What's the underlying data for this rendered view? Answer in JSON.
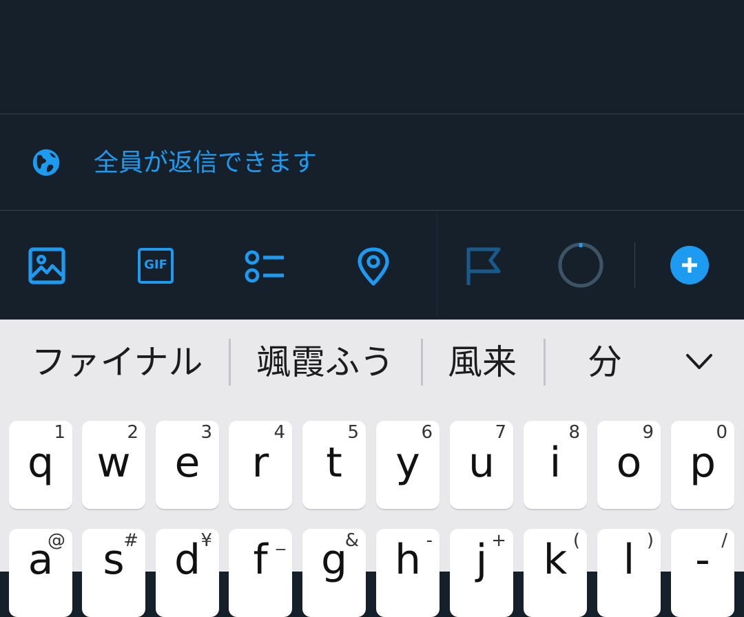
{
  "reply_setting": {
    "label": "全員が返信できます",
    "icon": "globe-icon"
  },
  "toolbar": {
    "icons": [
      "image-icon",
      "gif-icon",
      "poll-icon",
      "location-icon",
      "flag-icon",
      "character-counter-icon",
      "add-tweet-icon"
    ],
    "gif_text": "GIF"
  },
  "suggestions": [
    "ファイナル",
    "颯霞ふう",
    "風来",
    "分"
  ],
  "keyboard": {
    "row1": [
      {
        "key": "q",
        "hint": "1"
      },
      {
        "key": "w",
        "hint": "2"
      },
      {
        "key": "e",
        "hint": "3"
      },
      {
        "key": "r",
        "hint": "4"
      },
      {
        "key": "t",
        "hint": "5"
      },
      {
        "key": "y",
        "hint": "6"
      },
      {
        "key": "u",
        "hint": "7"
      },
      {
        "key": "i",
        "hint": "8"
      },
      {
        "key": "o",
        "hint": "9"
      },
      {
        "key": "p",
        "hint": "0"
      }
    ],
    "row2": [
      {
        "key": "a",
        "hint": "@"
      },
      {
        "key": "s",
        "hint": "#"
      },
      {
        "key": "d",
        "hint": "¥"
      },
      {
        "key": "f",
        "hint": "_"
      },
      {
        "key": "g",
        "hint": "&"
      },
      {
        "key": "h",
        "hint": "-"
      },
      {
        "key": "j",
        "hint": "+"
      },
      {
        "key": "k",
        "hint": "("
      },
      {
        "key": "l",
        "hint": ")"
      },
      {
        "key": "-",
        "hint": "/"
      }
    ]
  },
  "colors": {
    "accent": "#1d9bf0",
    "background": "#15202b",
    "divider": "#38444d",
    "keyboard_bg": "#e9e9eb"
  }
}
